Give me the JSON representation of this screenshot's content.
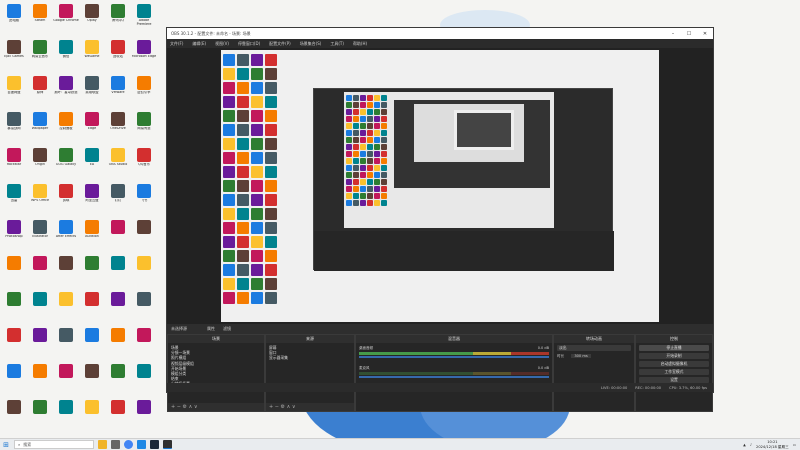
{
  "obs": {
    "title": "OBS 30.1.2 - 配置文件: 未命名 - 场景: 场景",
    "menu": [
      "文件(F)",
      "编辑(E)",
      "视图(V)",
      "停靠窗口(D)",
      "配置文件(P)",
      "场景集合(S)",
      "工具(T)",
      "帮助(H)"
    ],
    "midbar": [
      "未选择源",
      "属性",
      "滤镜"
    ],
    "docks": {
      "scenes": {
        "title": "场景",
        "items": [
          "场景",
          "分镜一场景",
          "照片模组",
          "视频层级模组",
          "开始场景",
          "模组分类",
          "结束",
          "山地场场景"
        ]
      },
      "sources": {
        "title": "来源",
        "items": [
          "屏幕",
          "窗口",
          "显示器采集"
        ]
      },
      "mixer": {
        "title": "混音器",
        "tracks": [
          {
            "name": "桌面音频",
            "level": "0.0 dB"
          },
          {
            "name": "麦克风",
            "level": "0.0 dB"
          }
        ]
      },
      "transitions": {
        "title": "转场动画",
        "type": "淡出",
        "duration_label": "时长",
        "duration": "300 ms"
      },
      "controls": {
        "title": "控制",
        "buttons": [
          "停止直播",
          "开始录制",
          "启动虚拟摄像机",
          "工作室模式",
          "设置",
          "退出"
        ]
      }
    },
    "status": [
      "LIVE: 00:00:00",
      "REC: 00:00:00",
      "CPU: 3.7%, 60.00 fps"
    ]
  },
  "taskbar": {
    "search_placeholder": "搜索",
    "time": "10:21",
    "date": "2024/12/18 星期三"
  },
  "desktop_icons": [
    "此电脑",
    "Steam",
    "Google Chrome",
    "Uplay",
    "腾讯QQ",
    "Adobe Premiere",
    "Epic Games",
    "网易云音乐",
    "微信",
    "WeGame",
    "回收站",
    "Microsoft Edge",
    "百度网盘",
    "原神",
    "崩坏：星穹铁道",
    "英雄联盟",
    "VMware",
    "虚幻引擎",
    "暴雪战网",
    "Wallpaper",
    "控制面板",
    "Edge",
    "OneDrive",
    "网易有道",
    "Rockstar",
    "Origin",
    "GOG Galaxy",
    "EA",
    "OBS Studio",
    "QQ音乐",
    "迅雷",
    "WPS Office",
    "剪映",
    "阿里云盘",
    "钉钉",
    "飞书",
    "Photoshop",
    "Illustrator",
    "After Effects",
    "Audition"
  ]
}
